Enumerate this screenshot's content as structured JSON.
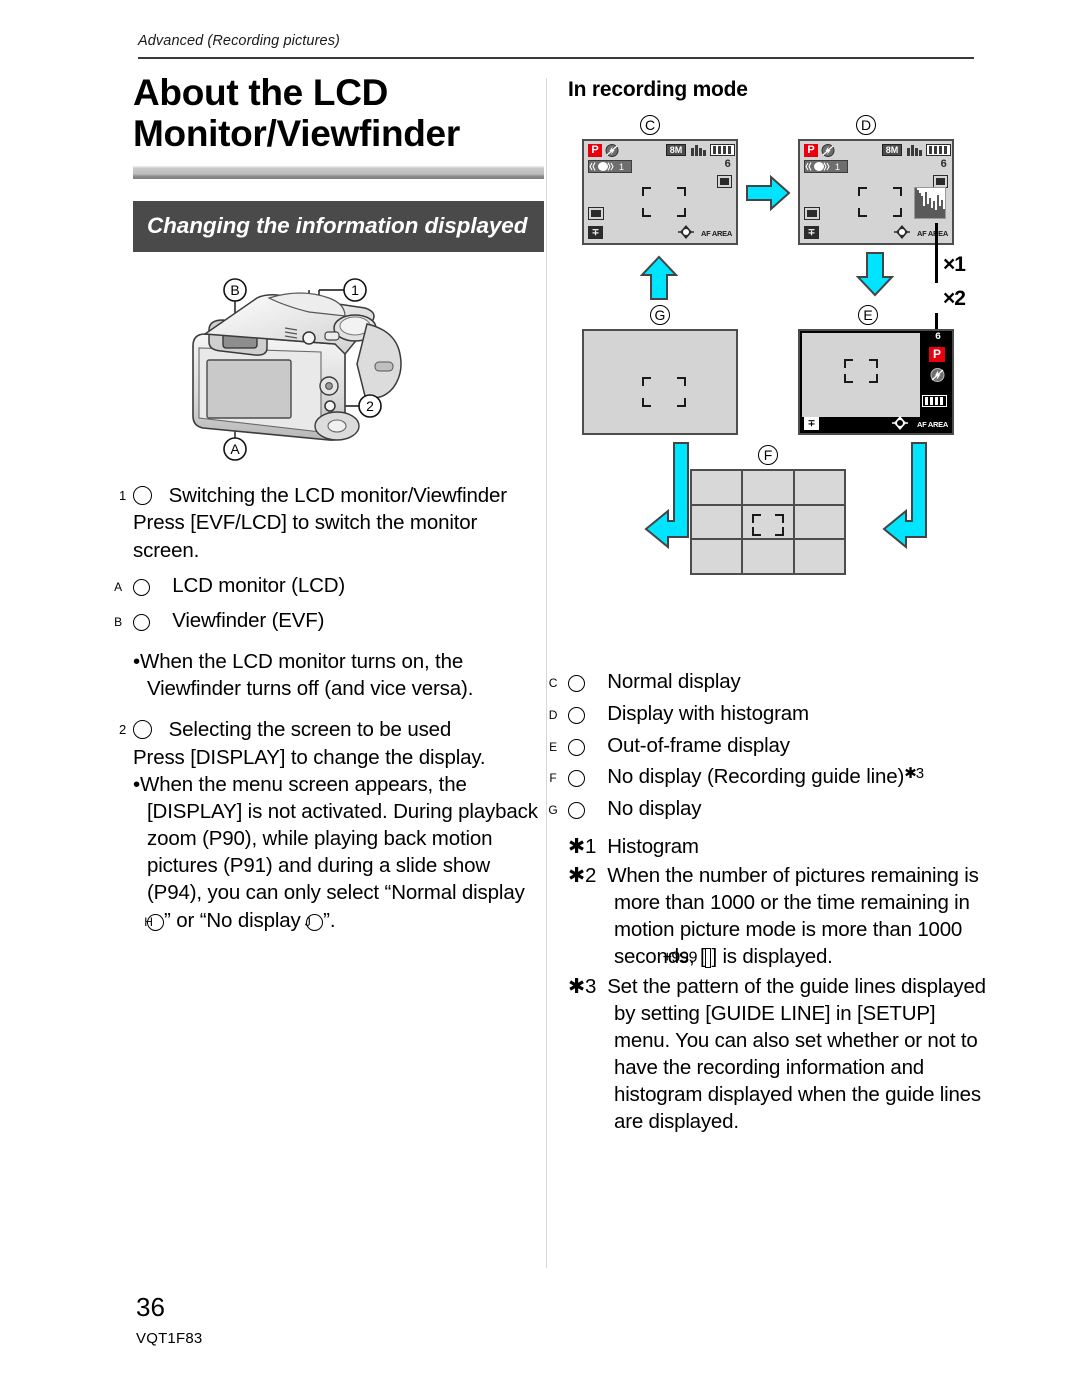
{
  "page": {
    "running_head": "Advanced (Recording pictures)",
    "number": "36",
    "model_code": "VQT1F83"
  },
  "left_column": {
    "chapter_title": "About the LCD Monitor/Viewfinder",
    "section_heading": "Changing the information displayed",
    "camera_figure": {
      "callouts": [
        "B",
        "1",
        "2",
        "A"
      ]
    },
    "step1": {
      "marker": "1",
      "heading": "Switching the LCD monitor/Viewfinder",
      "body": "Press [EVF/LCD] to switch the monitor screen."
    },
    "item_a": {
      "marker": "A",
      "label": "LCD monitor (LCD)"
    },
    "item_b": {
      "marker": "B",
      "label": "Viewfinder (EVF)"
    },
    "bullet1": "When the LCD monitor turns on, the Viewfinder turns off (and vice versa).",
    "step2": {
      "marker": "2",
      "heading": "Selecting the screen to be used",
      "body": "Press [DISPLAY] to change the display."
    },
    "bullet2_part1": "When the menu screen appears, the [DISPLAY] is not activated. During playback zoom (P90), while playing back motion pictures (P91) and during a slide show (P94), you can only select “Normal display ",
    "bullet2_marker_h": "H",
    "bullet2_part2": "” or “No display ",
    "bullet2_marker_j": "J",
    "bullet2_part3": "”."
  },
  "right_column": {
    "title": "In recording mode",
    "screens": {
      "c": {
        "label": "C",
        "mode_badge": "P",
        "flash_icon": "flash-off-icon",
        "stabilizer_icon": "image-stabilizer-icon",
        "stabilizer_mode": "1",
        "resolution": "8M",
        "quality_icon": "quality-fine-icon",
        "battery_icon": "battery-full-icon",
        "pictures_remaining": "6",
        "storage_icon": "internal-memory-icon",
        "metering_icon": "metering-icon",
        "ev_icon": "exposure-compensation-icon",
        "af_label": "AF AREA",
        "joystick_icon": "joystick-icon"
      },
      "d": {
        "label": "D",
        "mode_badge": "P",
        "resolution": "8M",
        "stabilizer_mode": "1",
        "pictures_remaining": "6",
        "af_label": "AF AREA",
        "histogram_icon": "histogram-icon"
      },
      "e": {
        "label": "E",
        "mode_badge": "P",
        "pictures_remaining": "6",
        "flash_icon": "flash-off-icon",
        "battery_icon": "battery-full-icon",
        "ev_icon": "exposure-compensation-icon",
        "af_label": "AF AREA"
      },
      "f": {
        "label": "F"
      },
      "g": {
        "label": "G"
      }
    },
    "callouts": {
      "star1": "×1",
      "star2": "×2"
    },
    "legend": [
      {
        "marker": "C",
        "text": "Normal display"
      },
      {
        "marker": "D",
        "text": "Display with histogram"
      },
      {
        "marker": "E",
        "text": "Out-of-frame display"
      },
      {
        "marker": "F",
        "text": "No display (Recording guide line)",
        "sup": "3"
      },
      {
        "marker": "G",
        "text": "No display"
      }
    ],
    "notes": {
      "n1_marker": "1",
      "n1": "Histogram",
      "n2_marker": "2",
      "n2_part1": "When the number of pictures remaining is more than 1000 or the time remaining in motion picture mode is more than 1000 seconds, [",
      "n2_chip": "+999",
      "n2_part2": "] is displayed.",
      "n3_marker": "3",
      "n3": "Set the pattern of the guide lines displayed by setting [GUIDE LINE] in [SETUP] menu. You can also set whether or not to have the recording information and histogram displayed when the guide lines are displayed."
    }
  },
  "colors": {
    "arrow_fill": "#00e5ff",
    "arrow_stroke": "#444444",
    "mode_badge_bg": "#e8000d",
    "section_bar_bg": "#4a4a4a",
    "screen_bg": "#d4d4d4"
  }
}
